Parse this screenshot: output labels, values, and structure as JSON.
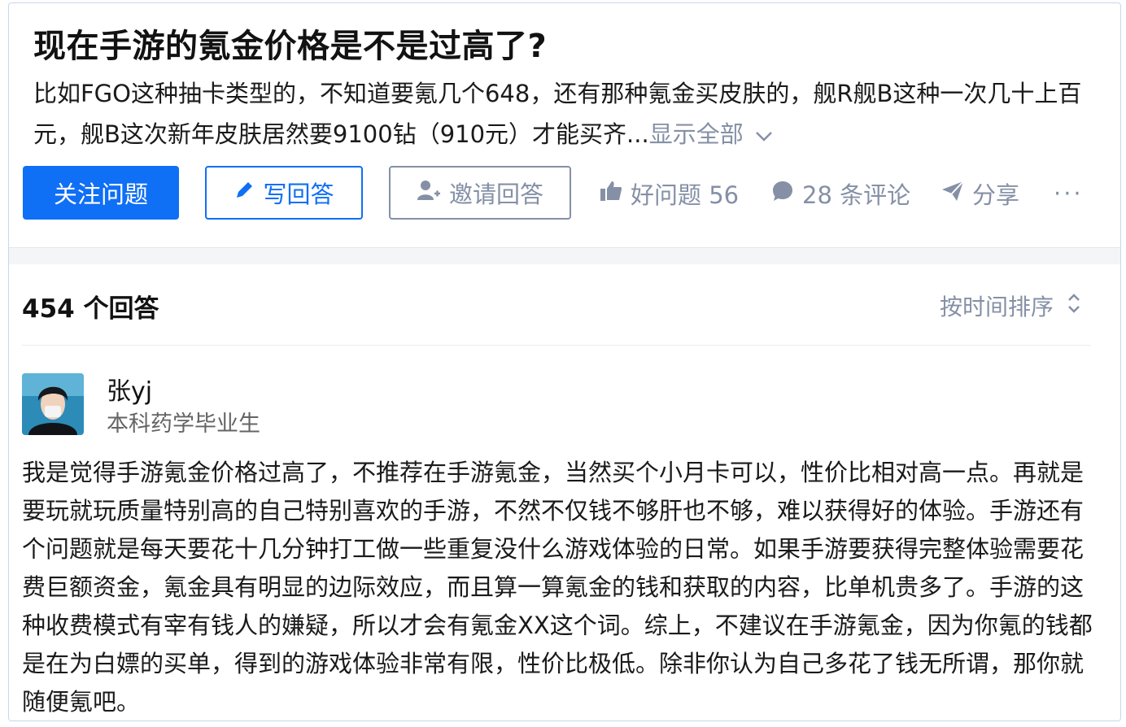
{
  "question": {
    "title": "现在手游的氪金价格是不是过高了?",
    "detail": "比如FGO这种抽卡类型的，不知道要氪几个648，还有那种氪金买皮肤的，舰R舰B这种一次几十上百元，舰B这次新年皮肤居然要9100钻（910元）才能买齐...",
    "expand_label": "显示全部"
  },
  "actions": {
    "follow_label": "关注问题",
    "write_label": "写回答",
    "invite_label": "邀请回答",
    "good_question_label": "好问题 56",
    "comments_label": "28 条评论",
    "share_label": "分享",
    "more_label": "···"
  },
  "answers_header": {
    "count_label": "454 个回答",
    "sort_label": "按时间排序"
  },
  "answer": {
    "author_name": "张yj",
    "author_bio": "本科药学毕业生",
    "content": "我是觉得手游氪金价格过高了，不推荐在手游氪金，当然买个小月卡可以，性价比相对高一点。再就是要玩就玩质量特别高的自己特别喜欢的手游，不然不仅钱不够肝也不够，难以获得好的体验。手游还有个问题就是每天要花十几分钟打工做一些重复没什么游戏体验的日常。如果手游要获得完整体验需要花费巨额资金，氪金具有明显的边际效应，而且算一算氪金的钱和获取的内容，比单机贵多了。手游的这种收费模式有宰有钱人的嫌疑，所以才会有氪金XX这个词。综上，不建议在手游氪金，因为你氪的钱都是在为白嫖的买单，得到的游戏体验非常有限，性价比极低。除非你认为自己多花了钱无所谓，那你就随便氪吧。"
  },
  "colors": {
    "primary": "#0f6ff5",
    "muted": "#8590a6",
    "text": "#121212"
  },
  "icons": [
    "pencil-icon",
    "invite-user-icon",
    "thumbs-up-icon",
    "comment-bubble-icon",
    "share-plane-icon",
    "chevron-down-icon",
    "sort-updown-icon"
  ]
}
